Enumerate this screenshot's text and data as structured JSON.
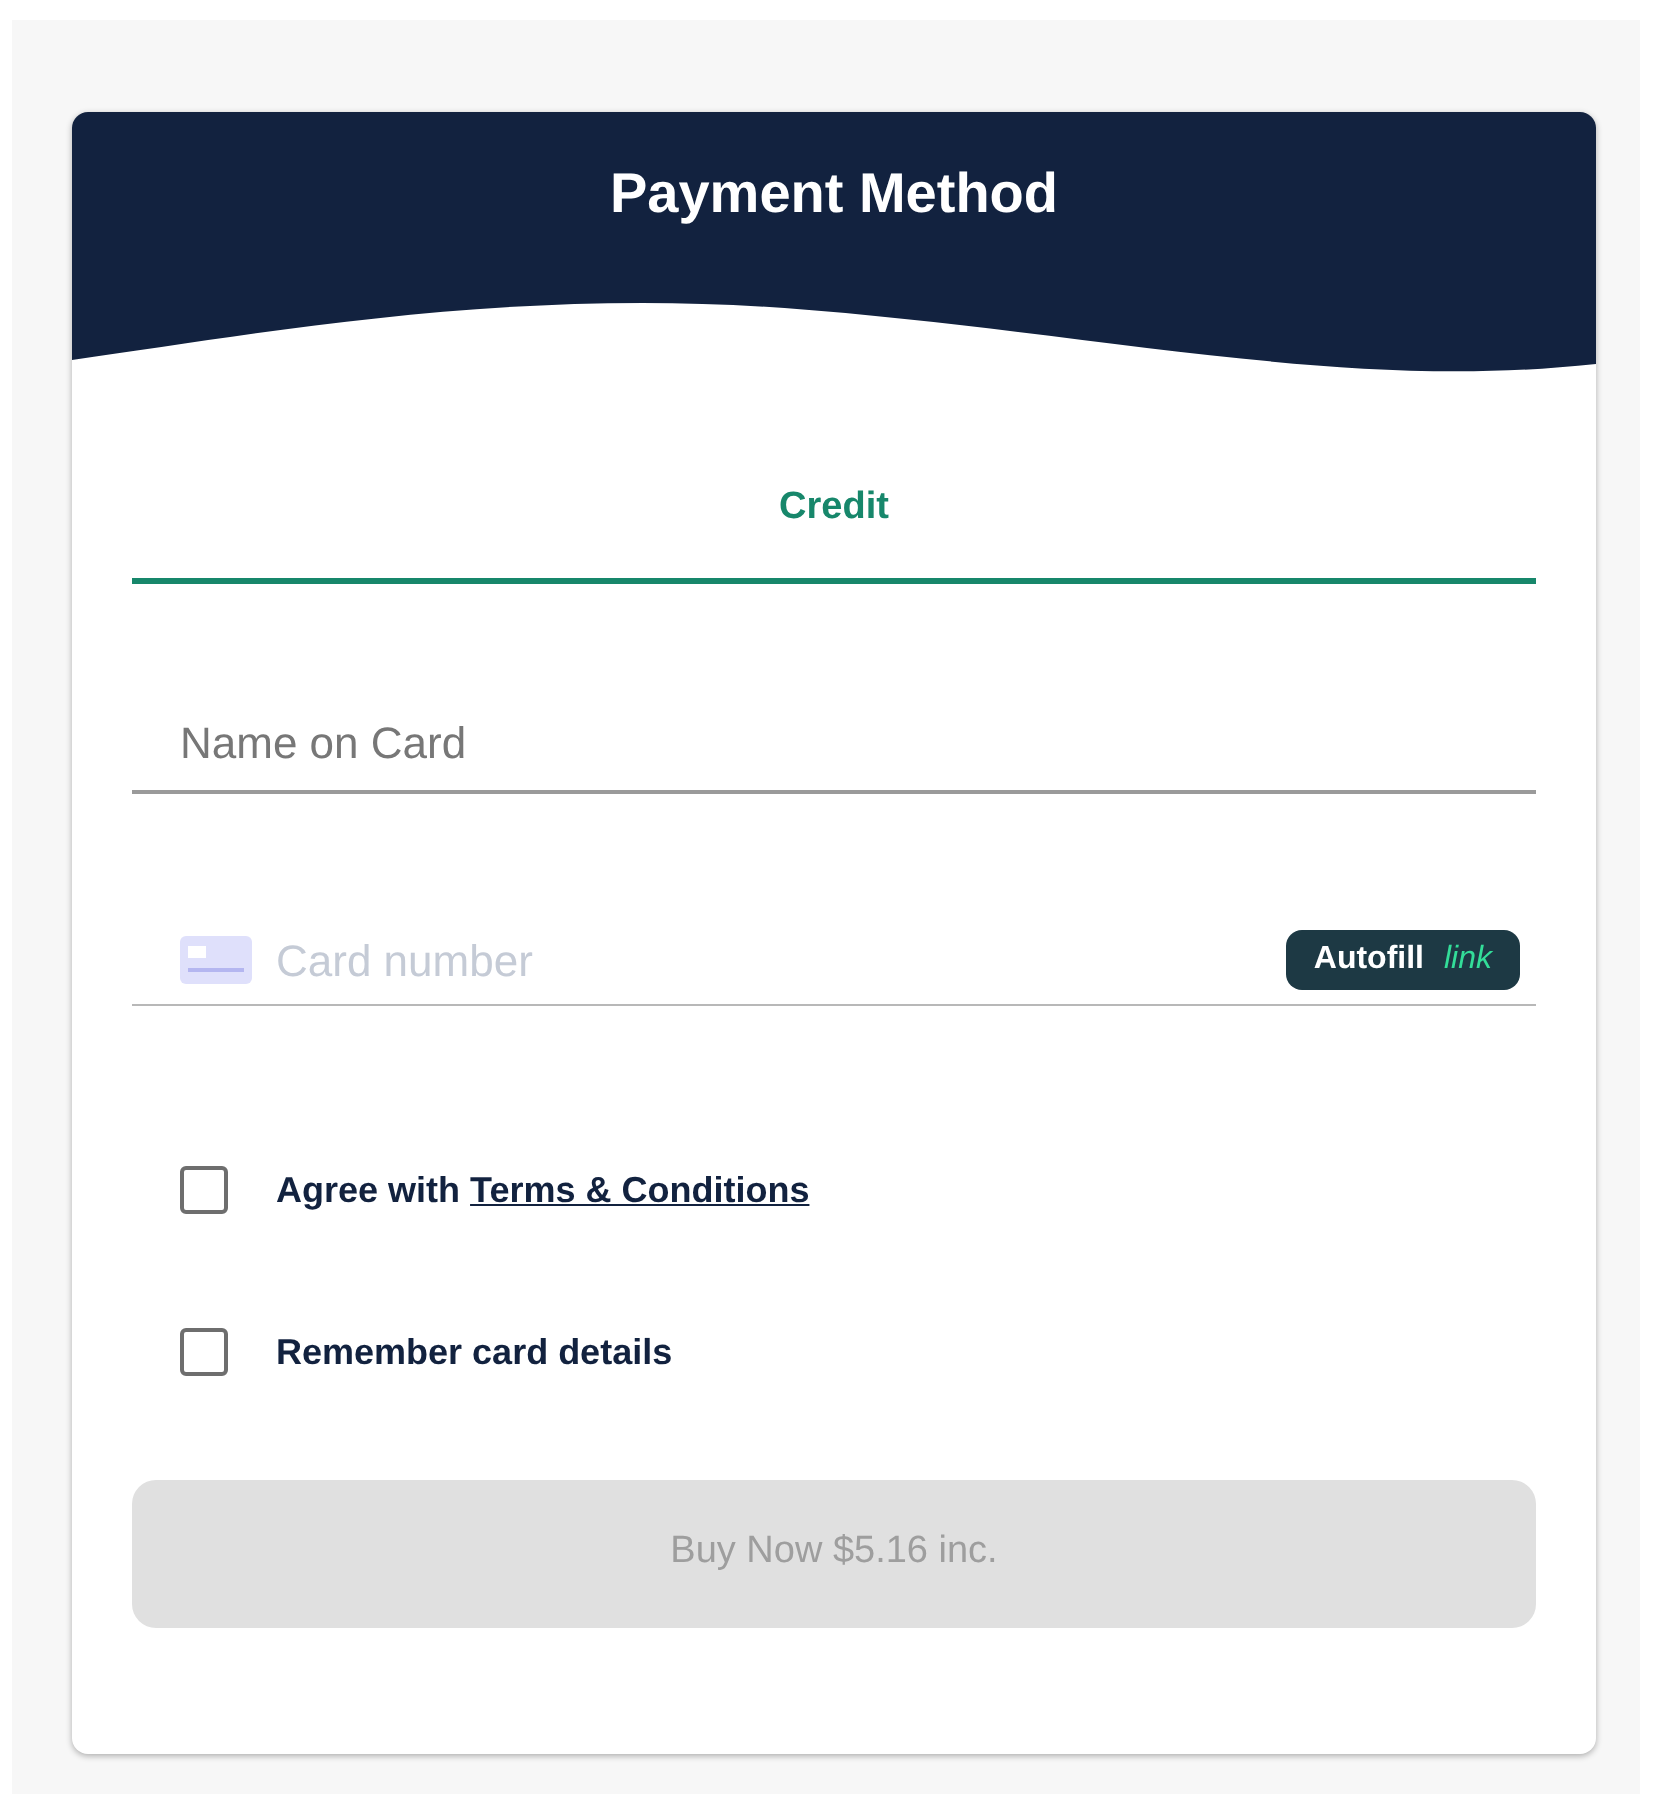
{
  "header": {
    "title": "Payment Method"
  },
  "tabs": [
    {
      "label": "Credit",
      "selected": true
    }
  ],
  "fields": [
    {
      "kind": "text",
      "placeholder": "Name on Card"
    },
    {
      "kind": "card",
      "placeholder": "Card number",
      "autofill": {
        "label": "Autofill",
        "brand": "link"
      }
    }
  ],
  "checkboxes": [
    {
      "text": "Agree with",
      "link": "Terms & Conditions",
      "checked": false
    },
    {
      "text": "Remember card details",
      "checked": false
    }
  ],
  "submit": {
    "label": "Buy Now $5.16 inc.",
    "disabled": true
  }
}
